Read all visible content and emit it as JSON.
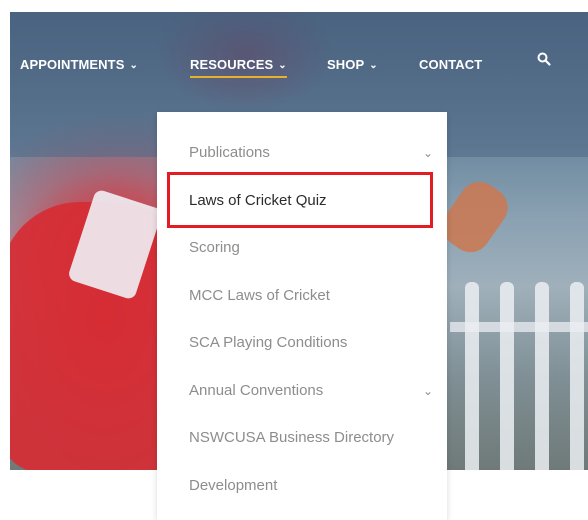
{
  "nav": {
    "items": [
      {
        "label": "APPOINTMENTS",
        "chevron": "⌄"
      },
      {
        "label": "RESOURCES",
        "chevron": "⌄"
      },
      {
        "label": "SHOP",
        "chevron": "⌄"
      },
      {
        "label": "CONTACT",
        "chevron": ""
      }
    ],
    "active_item": "RESOURCES",
    "search_icon": "search-icon"
  },
  "dropdown": {
    "items": [
      {
        "label": "Publications",
        "has_submenu": true,
        "chevron": "⌄"
      },
      {
        "label": "Laws of Cricket Quiz",
        "has_submenu": false,
        "highlighted": true
      },
      {
        "label": "Scoring",
        "has_submenu": false
      },
      {
        "label": "MCC Laws of Cricket",
        "has_submenu": false
      },
      {
        "label": "SCA Playing Conditions",
        "has_submenu": false
      },
      {
        "label": "Annual Conventions",
        "has_submenu": true,
        "chevron": "⌄"
      },
      {
        "label": "NSWCUSA Business Directory",
        "has_submenu": false
      },
      {
        "label": "Development",
        "has_submenu": false
      }
    ]
  },
  "colors": {
    "accent_underline": "#e8b12a",
    "highlight_border": "#e31b23",
    "menu_text": "#8d8d8d",
    "menu_text_active": "#2b2b2b"
  }
}
